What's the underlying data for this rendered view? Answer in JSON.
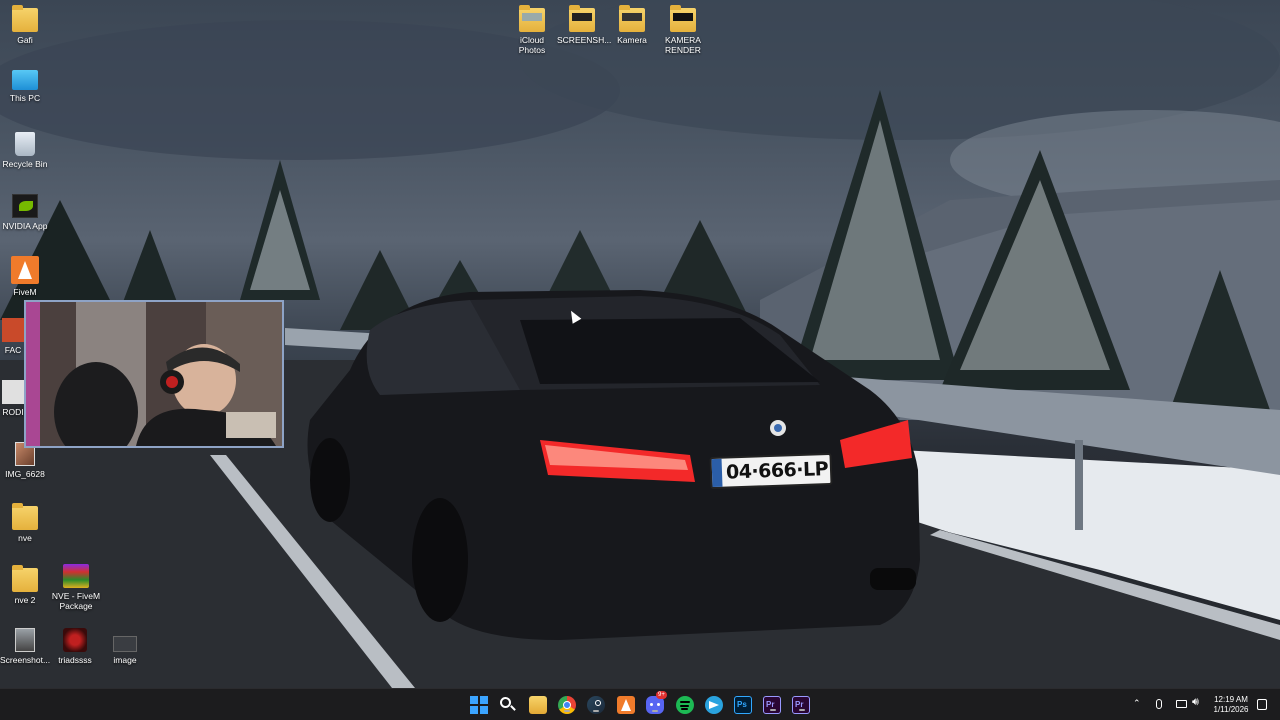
{
  "desktop": {
    "icons": [
      {
        "label": "Gafi",
        "icon": "folder-icon"
      },
      {
        "label": "This PC",
        "icon": "monitor-icon"
      },
      {
        "label": "Recycle Bin",
        "icon": "recycle-bin-icon"
      },
      {
        "label": "NVIDIA App",
        "icon": "nvidia-icon"
      },
      {
        "label": "FiveM",
        "icon": "fivem-icon"
      },
      {
        "label": "FAC",
        "icon": "shortcut-icon"
      },
      {
        "label": "RODI",
        "icon": "shortcut-icon"
      },
      {
        "label": "IMG_6628",
        "icon": "image-icon"
      },
      {
        "label": "nve",
        "icon": "folder-icon"
      },
      {
        "label": "nve 2",
        "icon": "folder-icon"
      },
      {
        "label": "NVE - FiveM Package",
        "icon": "winrar-icon"
      },
      {
        "label": "Screenshot...",
        "icon": "image-icon"
      },
      {
        "label": "triadssss",
        "icon": "image-icon"
      },
      {
        "label": "image",
        "icon": "image-icon"
      },
      {
        "label": "iCloud Photos",
        "icon": "folder-icon"
      },
      {
        "label": "SCREENSH...",
        "icon": "folder-icon"
      },
      {
        "label": "Kamera",
        "icon": "folder-icon"
      },
      {
        "label": "KAMERA RENDER",
        "icon": "folder-icon"
      }
    ],
    "wallpaper": {
      "license_plate": "04·666·LP",
      "accent_taillight": "#ff2a2a",
      "sky": "#4a5563",
      "snow": "#e8ecf0"
    }
  },
  "taskbar": {
    "apps": [
      {
        "name": "start-button",
        "color": "#3ba4ff"
      },
      {
        "name": "search-icon",
        "color": "#ffffff"
      },
      {
        "name": "file-explorer-icon",
        "color": "#f3c24a"
      },
      {
        "name": "chrome-icon",
        "color": "#4285f4"
      },
      {
        "name": "steam-icon",
        "color": "#1b2838"
      },
      {
        "name": "fivem-icon",
        "color": "#f07b2b"
      },
      {
        "name": "discord-icon",
        "color": "#5865f2"
      },
      {
        "name": "spotify-icon",
        "color": "#1db954"
      },
      {
        "name": "telegram-icon",
        "color": "#2aa3df"
      },
      {
        "name": "photoshop-icon",
        "color": "#001e36"
      },
      {
        "name": "premiere-icon",
        "color": "#2a0634"
      },
      {
        "name": "premiere-icon-2",
        "color": "#2a0634"
      }
    ],
    "app_labels": [
      "Ps",
      "Pr",
      "Pr"
    ],
    "discord_badge": "9+",
    "clock": {
      "time": "12:19 AM",
      "date": "1/11/2026"
    }
  }
}
